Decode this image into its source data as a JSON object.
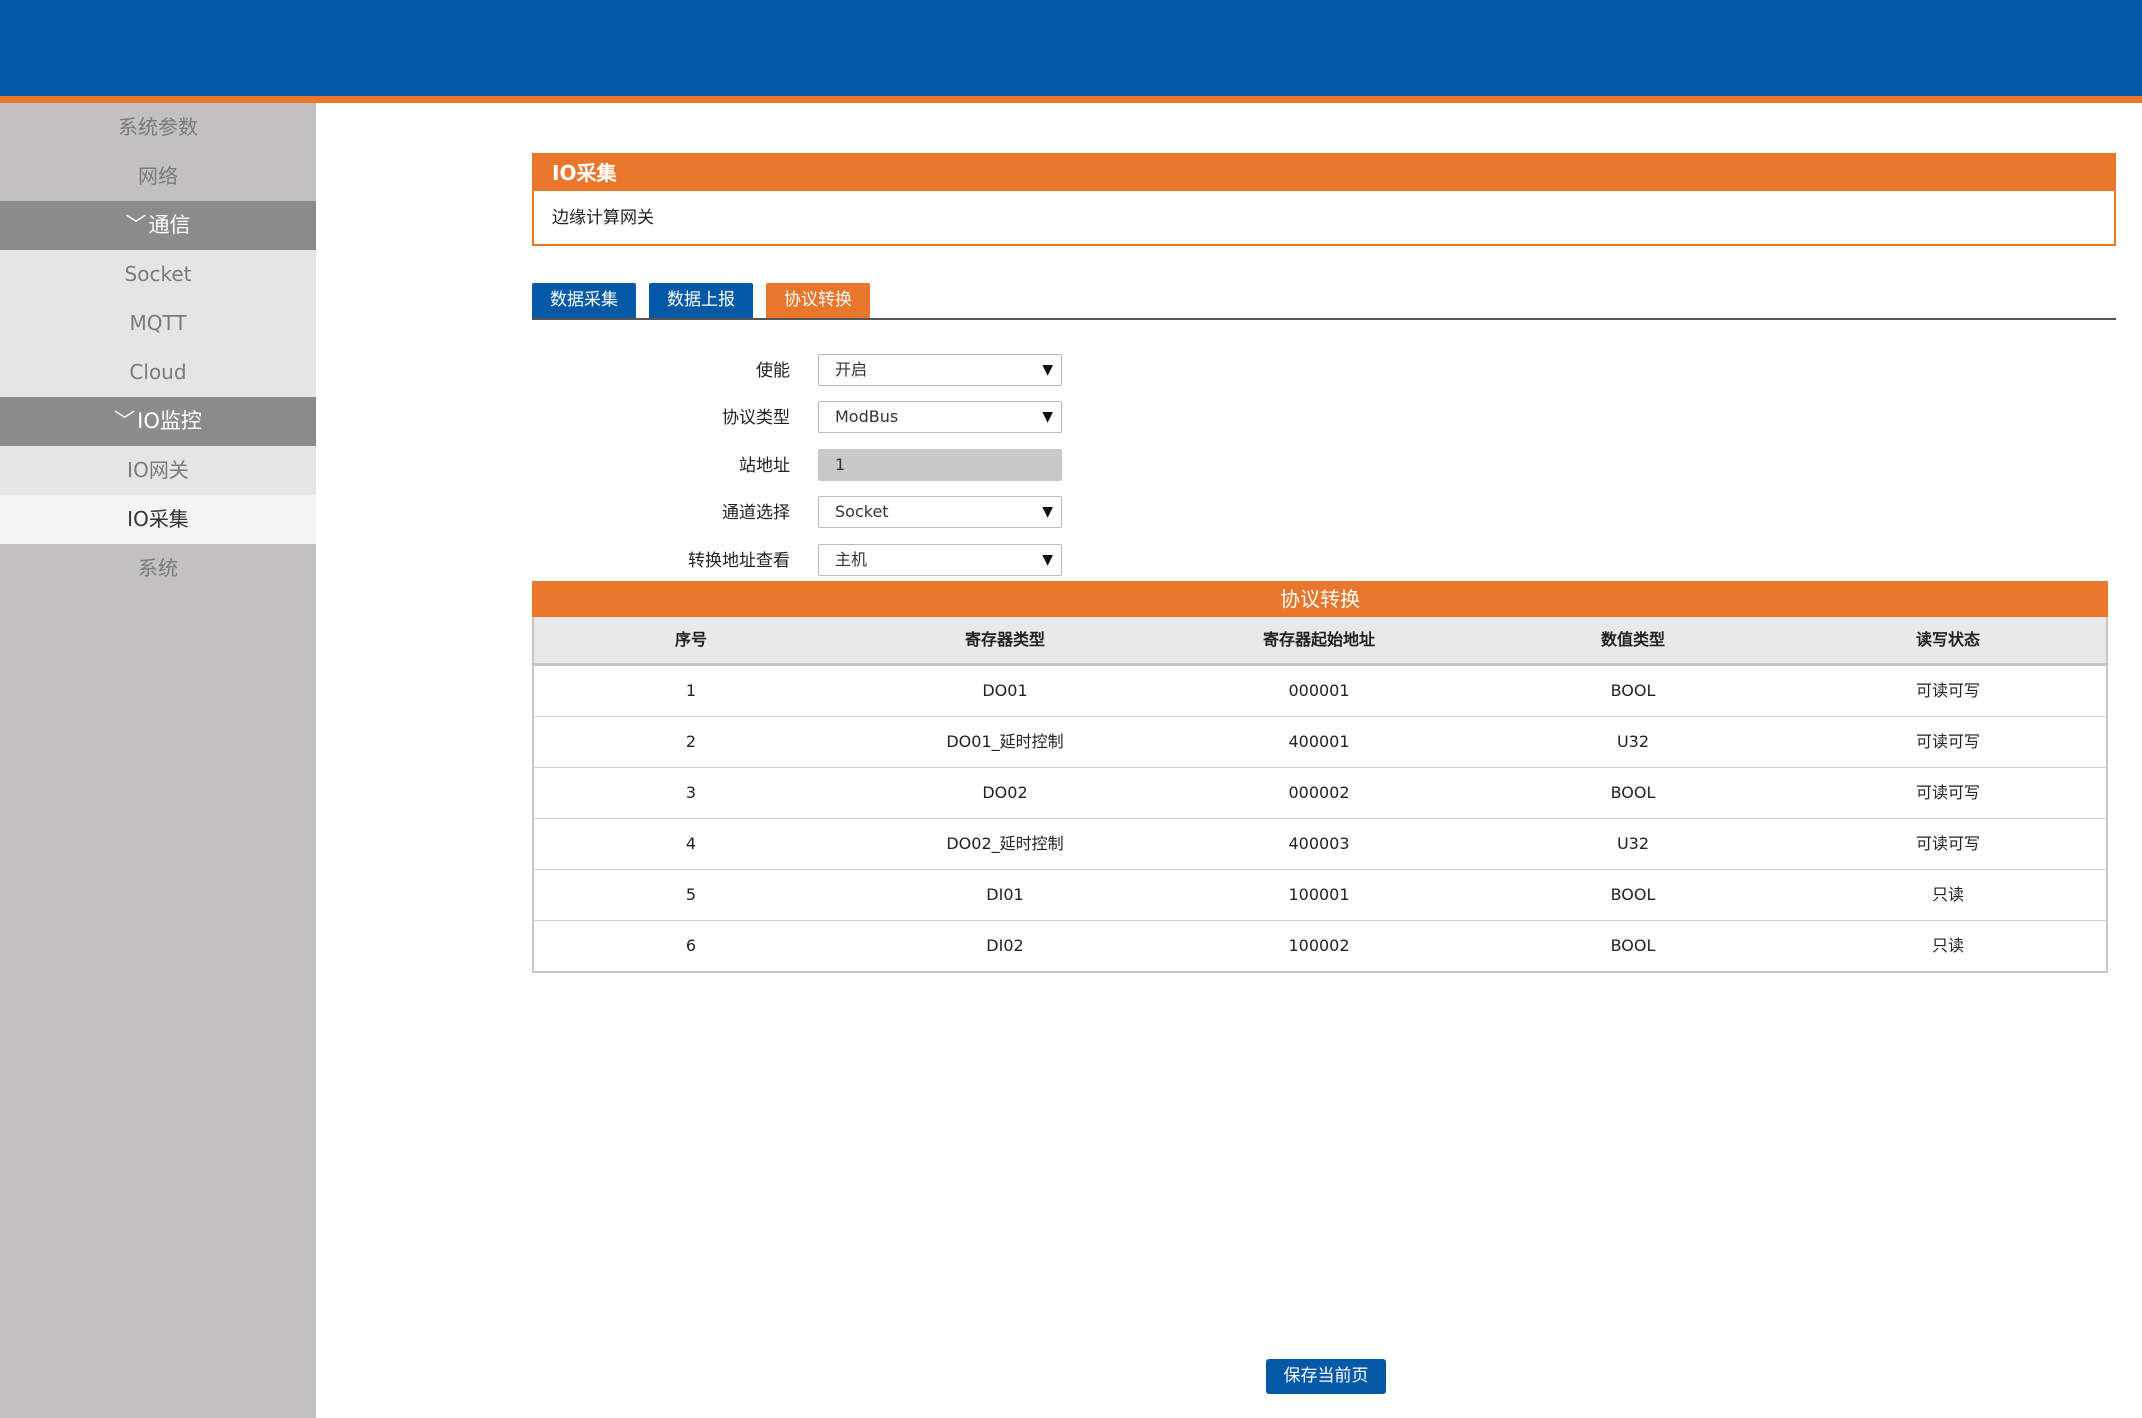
{
  "colors": {
    "header": "#0459a7",
    "accent": "#e8762b",
    "sidebar": "#c2c0c1",
    "sidebar_group": "#8c8b8c"
  },
  "sidebar": {
    "items": [
      {
        "label": "系统参数"
      },
      {
        "label": "网络"
      },
      {
        "label": "通信",
        "group": true
      },
      {
        "label": "Socket"
      },
      {
        "label": "MQTT"
      },
      {
        "label": "Cloud"
      },
      {
        "label": "IO监控",
        "group": true
      },
      {
        "label": "IO网关"
      },
      {
        "label": "IO采集",
        "active": true
      },
      {
        "label": "系统"
      }
    ]
  },
  "panel": {
    "title": "IO采集",
    "subtitle": "边缘计算网关"
  },
  "tabs": [
    {
      "label": "数据采集"
    },
    {
      "label": "数据上报"
    },
    {
      "label": "协议转换",
      "active": true
    }
  ],
  "form": {
    "enable": {
      "label": "使能",
      "value": "开启"
    },
    "protocol": {
      "label": "协议类型",
      "value": "ModBus"
    },
    "station": {
      "label": "站地址",
      "value": "1"
    },
    "channel": {
      "label": "通道选择",
      "value": "Socket"
    },
    "address_view": {
      "label": "转换地址查看",
      "value": "主机"
    }
  },
  "grid": {
    "title": "协议转换",
    "columns": [
      "序号",
      "寄存器类型",
      "寄存器起始地址",
      "数值类型",
      "读写状态"
    ],
    "rows": [
      [
        "1",
        "DO01",
        "000001",
        "BOOL",
        "可读可写"
      ],
      [
        "2",
        "DO01_延时控制",
        "400001",
        "U32",
        "可读可写"
      ],
      [
        "3",
        "DO02",
        "000002",
        "BOOL",
        "可读可写"
      ],
      [
        "4",
        "DO02_延时控制",
        "400003",
        "U32",
        "可读可写"
      ],
      [
        "5",
        "DI01",
        "100001",
        "BOOL",
        "只读"
      ],
      [
        "6",
        "DI02",
        "100002",
        "BOOL",
        "只读"
      ]
    ]
  },
  "save_label": "保存当前页"
}
